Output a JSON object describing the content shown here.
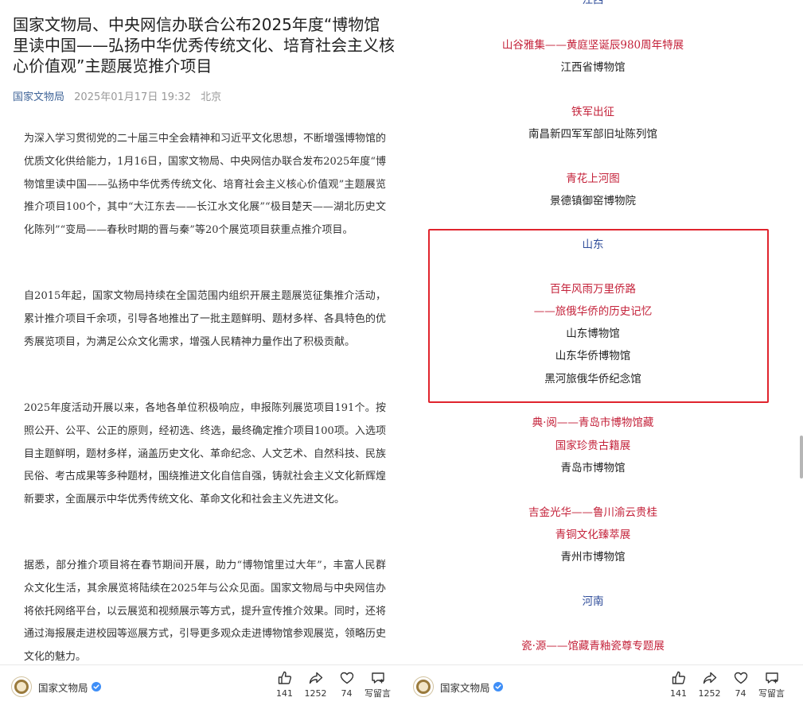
{
  "article": {
    "title": "国家文物局、中央网信办联合公布2025年度“博物馆里读中国——弘扬中华优秀传统文化、培育社会主义核心价值观”主题展览推介项目",
    "author": "国家文物局",
    "datetime": "2025年01月17日 19:32",
    "location": "北京",
    "paragraphs": [
      "为深入学习贯彻党的二十届三中全会精神和习近平文化思想，不断增强博物馆的优质文化供给能力，1月16日，国家文物局、中央网信办联合发布2025年度“博物馆里读中国——弘扬中华优秀传统文化、培育社会主义核心价值观”主题展览推介项目100个，其中“大江东去——长江水文化展”“极目楚天——湖北历史文化陈列”“变局——春秋时期的晋与秦”等20个展览项目获重点推介项目。",
      "自2015年起，国家文物局持续在全国范围内组织开展主题展览征集推介活动，累计推介项目千余项，引导各地推出了一批主题鲜明、题材多样、各具特色的优秀展览项目，为满足公众文化需求，增强人民精神力量作出了积极贡献。",
      "2025年度活动开展以来，各地各单位积极响应，申报陈列展览项目191个。按照公开、公平、公正的原则，经初选、终选，最终确定推介项目100项。入选项目主题鲜明，题材多样，涵盖历史文化、革命纪念、人文艺术、自然科技、民族民俗、考古成果等多种题材，围绕推进文化自信自强，铸就社会主义文化新辉煌新要求，全面展示中华优秀传统文化、革命文化和社会主义先进文化。",
      "据悉，部分推介项目将在春节期间开展，助力“博物馆里过大年”，丰富人民群众文化生活，其余展览将陆续在2025年与公众见面。国家文物局与中央网信办将依托网络平台，以云展览和视频展示等方式，提升宣传推介效果。同时，还将通过海报展走进校园等巡展方式，引导更多观众走进博物馆参观展览，领略历史文化的魅力。"
    ]
  },
  "list": {
    "jiangxi": {
      "province": "江西",
      "items": [
        {
          "title": "山谷雅集——黄庭坚诞辰980周年特展",
          "org": "江西省博物馆"
        },
        {
          "title": "铁军出征",
          "org": "南昌新四军军部旧址陈列馆"
        },
        {
          "title": "青花上河图",
          "org": "景德镇御窑博物院"
        }
      ]
    },
    "shandong": {
      "province": "山东",
      "highlighted": {
        "title_line1": "百年风雨万里侨路",
        "title_line2": "——旅俄华侨的历史记忆",
        "orgs": [
          "山东博物馆",
          "山东华侨博物馆",
          "黑河旅俄华侨纪念馆"
        ]
      },
      "items": [
        {
          "title_line1": "典·阅——青岛市博物馆藏",
          "title_line2": "国家珍贵古籍展",
          "org": "青岛市博物馆"
        },
        {
          "title_line1": "吉金光华——鲁川渝云贵桂",
          "title_line2": "青铜文化臻萃展",
          "org": "青州市博物馆"
        }
      ]
    },
    "henan": {
      "province": "河南",
      "items": [
        {
          "title": "瓷·源——馆藏青釉瓷尊专题展"
        }
      ]
    }
  },
  "bottom_bar": {
    "account_name": "国家文物局",
    "like_count": "141",
    "share_count": "1252",
    "favorite_count": "74",
    "comment_label": "写留言"
  },
  "colors": {
    "province": "#2f4d9a",
    "exhibit_title": "#c4223a",
    "highlight_border": "#e0242d",
    "author_link": "#406599"
  }
}
